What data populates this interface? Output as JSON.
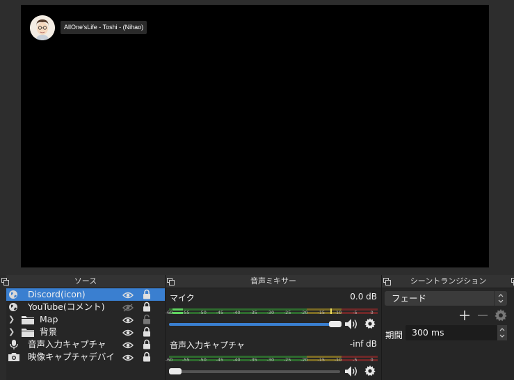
{
  "preview": {
    "overlay_name": "AllOne'sLife - Toshi - (Nihao)"
  },
  "sources_dock": {
    "title": "ソース",
    "items": [
      {
        "label": "Discord(icon)",
        "icon": "globe-icon",
        "visible": true,
        "locked": true,
        "selected": true
      },
      {
        "label": "YouTube(コメント)",
        "icon": "globe-icon",
        "visible": false,
        "locked": true,
        "selected": false
      },
      {
        "label": "Map",
        "icon": "folder-icon",
        "visible": true,
        "locked": false,
        "group": true
      },
      {
        "label": "背景",
        "icon": "folder-icon",
        "visible": true,
        "locked": true,
        "group": true
      },
      {
        "label": "音声入力キャプチャ",
        "icon": "microphone-icon",
        "visible": true,
        "locked": true
      },
      {
        "label": "映像キャプチャデバイ",
        "icon": "camera-icon",
        "visible": true,
        "locked": true
      }
    ]
  },
  "mixer_dock": {
    "title": "音声ミキサー",
    "scale_labels": [
      "-60",
      "-55",
      "-50",
      "-45",
      "-40",
      "-35",
      "-30",
      "-25",
      "-20",
      "-15",
      "-10",
      "-5",
      "0"
    ],
    "channels": [
      {
        "name": "マイク",
        "db": "0.0 dB",
        "volume": 1.0
      },
      {
        "name": "音声入力キャプチャ",
        "db": "-inf dB",
        "volume": 0.0
      }
    ]
  },
  "transitions_dock": {
    "title": "シーントランジション",
    "selected": "フェード",
    "duration_label": "期間",
    "duration_value": "300 ms"
  },
  "colors": {
    "selection": "#3a7fd0",
    "meter_green": "#4caf50",
    "meter_yellow": "#c9b13a",
    "meter_red": "#b03a3a"
  }
}
